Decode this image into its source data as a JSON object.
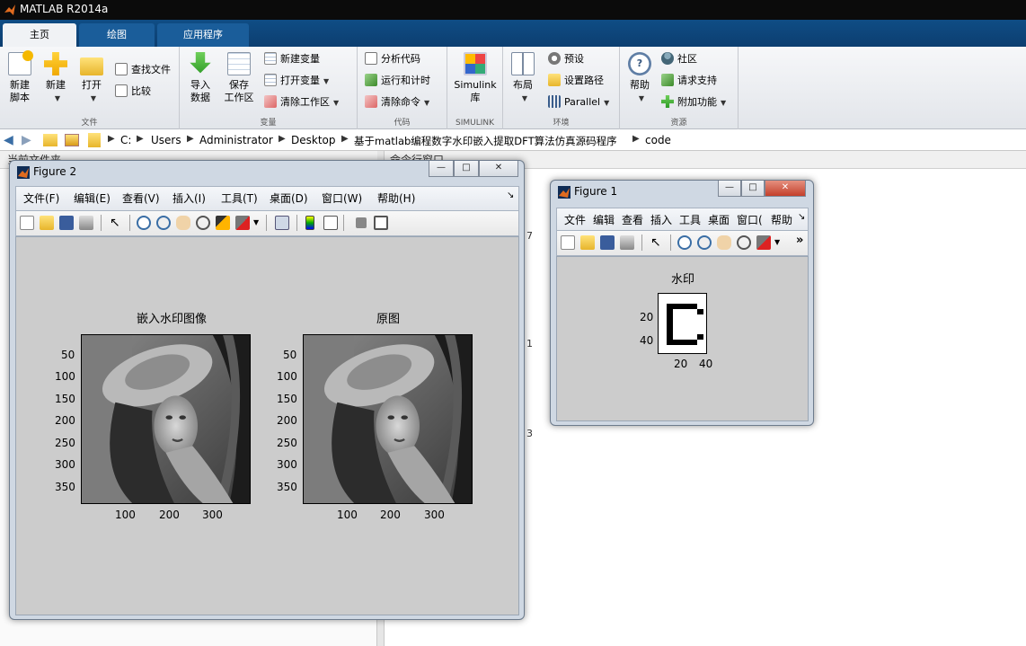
{
  "app": {
    "title": "MATLAB R2014a"
  },
  "tabs": [
    {
      "label": "主页",
      "active": true
    },
    {
      "label": "绘图",
      "active": false
    },
    {
      "label": "应用程序",
      "active": false
    }
  ],
  "ribbon": {
    "file": {
      "label": "文件",
      "new_script": "新建\n脚本",
      "new_script_l1": "新建",
      "new_script_l2": "脚本",
      "new": "新建",
      "open": "打开",
      "find_files": "查找文件",
      "compare": "比较"
    },
    "variable": {
      "label": "变量",
      "import_l1": "导入",
      "import_l2": "数据",
      "save_l1": "保存",
      "save_l2": "工作区",
      "new_var": "新建变量",
      "open_var": "打开变量",
      "clear_ws": "清除工作区"
    },
    "code": {
      "label": "代码",
      "analyze": "分析代码",
      "run_time": "运行和计时",
      "clear_cmd": "清除命令"
    },
    "simulink": {
      "label": "SIMULINK",
      "lib_l1": "Simulink",
      "lib_l2": "库"
    },
    "env": {
      "label": "环境",
      "layout": "布局",
      "prefs": "预设",
      "set_path": "设置路径",
      "parallel": "Parallel"
    },
    "resources": {
      "label": "资源",
      "help": "帮助",
      "community": "社区",
      "support": "请求支持",
      "addons": "附加功能"
    }
  },
  "address": {
    "crumbs": [
      "C:",
      "Users",
      "Administrator",
      "Desktop",
      "基于matlab编程数字水印嵌入提取DFT算法仿真源码程序",
      "code"
    ]
  },
  "panes": {
    "current_folder": "当前文件夹",
    "command_window": "命令行窗口",
    "side_nums": [
      "7",
      "1",
      "3"
    ]
  },
  "figure2": {
    "title": "Figure 2",
    "menus": [
      "文件(F)",
      "编辑(E)",
      "查看(V)",
      "插入(I)",
      "工具(T)",
      "桌面(D)",
      "窗口(W)",
      "帮助(H)"
    ],
    "menu_arrow": "↘",
    "axes": [
      {
        "title": "嵌入水印图像",
        "yticks": [
          "50",
          "100",
          "150",
          "200",
          "250",
          "300",
          "350"
        ],
        "xticks": [
          "100",
          "200",
          "300"
        ]
      },
      {
        "title": "原图",
        "yticks": [
          "50",
          "100",
          "150",
          "200",
          "250",
          "300",
          "350"
        ],
        "xticks": [
          "100",
          "200",
          "300"
        ]
      }
    ]
  },
  "figure1": {
    "title": "Figure 1",
    "menus": [
      "文件",
      "编辑",
      "查看",
      "插入",
      "工具",
      "桌面",
      "窗口(",
      "帮助"
    ],
    "menu_arrow": "↘",
    "toolbar_more": "»",
    "axes": {
      "title": "水印",
      "yticks": [
        "20",
        "40"
      ],
      "xticks": [
        "20",
        "40"
      ]
    }
  },
  "window_buttons": {
    "min": "—",
    "max": "□",
    "close": "✕"
  }
}
